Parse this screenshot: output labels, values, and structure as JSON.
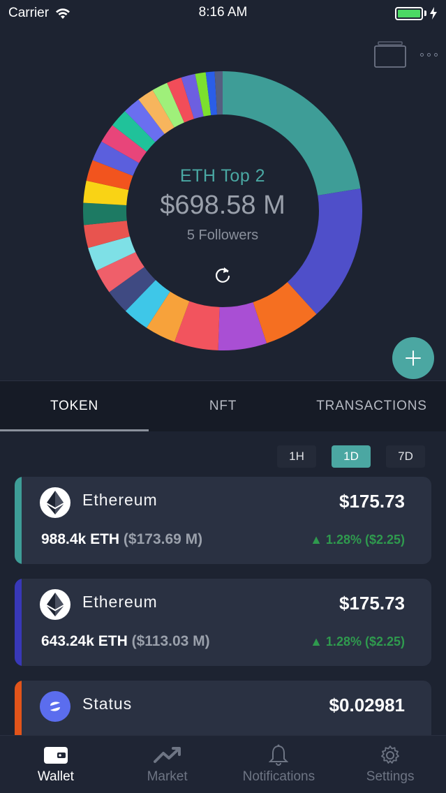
{
  "status_bar": {
    "carrier": "Carrier",
    "time": "8:16 AM",
    "battery_color": "#4cd964"
  },
  "header_icons": [
    "cards-icon",
    "more-dots-icon"
  ],
  "wallet": {
    "name": "ETH Top 2",
    "value": "$698.58 M",
    "followers": "5 Followers"
  },
  "donut": {
    "slices": [
      {
        "value": 22.0,
        "color": "#3e9d97"
      },
      {
        "value": 15.5,
        "color": "#4f4fc9"
      },
      {
        "value": 6.5,
        "color": "#f56f21"
      },
      {
        "value": 5.5,
        "color": "#a94fd4"
      },
      {
        "value": 5.0,
        "color": "#f2545e"
      },
      {
        "value": 3.5,
        "color": "#f7a23b"
      },
      {
        "value": 3.0,
        "color": "#3ec7e8"
      },
      {
        "value": 2.8,
        "color": "#3f4a82"
      },
      {
        "value": 2.8,
        "color": "#ef5f6a"
      },
      {
        "value": 2.7,
        "color": "#7ee0e6"
      },
      {
        "value": 2.6,
        "color": "#e8544f"
      },
      {
        "value": 2.5,
        "color": "#1d7a63"
      },
      {
        "value": 2.5,
        "color": "#f9d315"
      },
      {
        "value": 2.4,
        "color": "#f2541e"
      },
      {
        "value": 2.3,
        "color": "#5b5fdd"
      },
      {
        "value": 2.2,
        "color": "#e8457a"
      },
      {
        "value": 2.1,
        "color": "#20c29a"
      },
      {
        "value": 2.0,
        "color": "#6a6ff0"
      },
      {
        "value": 1.9,
        "color": "#f7b55d"
      },
      {
        "value": 1.8,
        "color": "#9ff07a"
      },
      {
        "value": 1.7,
        "color": "#f24d59"
      },
      {
        "value": 1.6,
        "color": "#6d5fe0"
      },
      {
        "value": 1.2,
        "color": "#7ce02f"
      },
      {
        "value": 1.0,
        "color": "#2a5ee8"
      },
      {
        "value": 0.9,
        "color": "#555e80"
      }
    ]
  },
  "tabs": [
    {
      "label": "TOKEN",
      "active": true
    },
    {
      "label": "NFT",
      "active": false
    },
    {
      "label": "TRANSACTIONS",
      "active": false
    }
  ],
  "ranges": [
    {
      "label": "1H",
      "active": false
    },
    {
      "label": "1D",
      "active": true
    },
    {
      "label": "7D",
      "active": false
    }
  ],
  "tokens": [
    {
      "name": "Ethereum",
      "price": "$175.73",
      "holding": "988.4k ETH",
      "holding_usd": "($173.69 M)",
      "change": "▲ 1.28% ($2.25)",
      "accent": "#3e9d97",
      "icon": "ethereum-icon"
    },
    {
      "name": "Ethereum",
      "price": "$175.73",
      "holding": "643.24k ETH",
      "holding_usd": "($113.03 M)",
      "change": "▲ 1.28% ($2.25)",
      "accent": "#3838b8",
      "icon": "ethereum-icon"
    },
    {
      "name": "Status",
      "price": "$0.02981",
      "holding": "",
      "holding_usd": "",
      "change": "",
      "accent": "#e2541a",
      "icon": "status-icon"
    }
  ],
  "bottom_nav": [
    {
      "label": "Wallet",
      "icon": "wallet-icon",
      "active": true
    },
    {
      "label": "Market",
      "icon": "market-chart-icon",
      "active": false
    },
    {
      "label": "Notifications",
      "icon": "bell-icon",
      "active": false
    },
    {
      "label": "Settings",
      "icon": "gear-icon",
      "active": false
    }
  ]
}
